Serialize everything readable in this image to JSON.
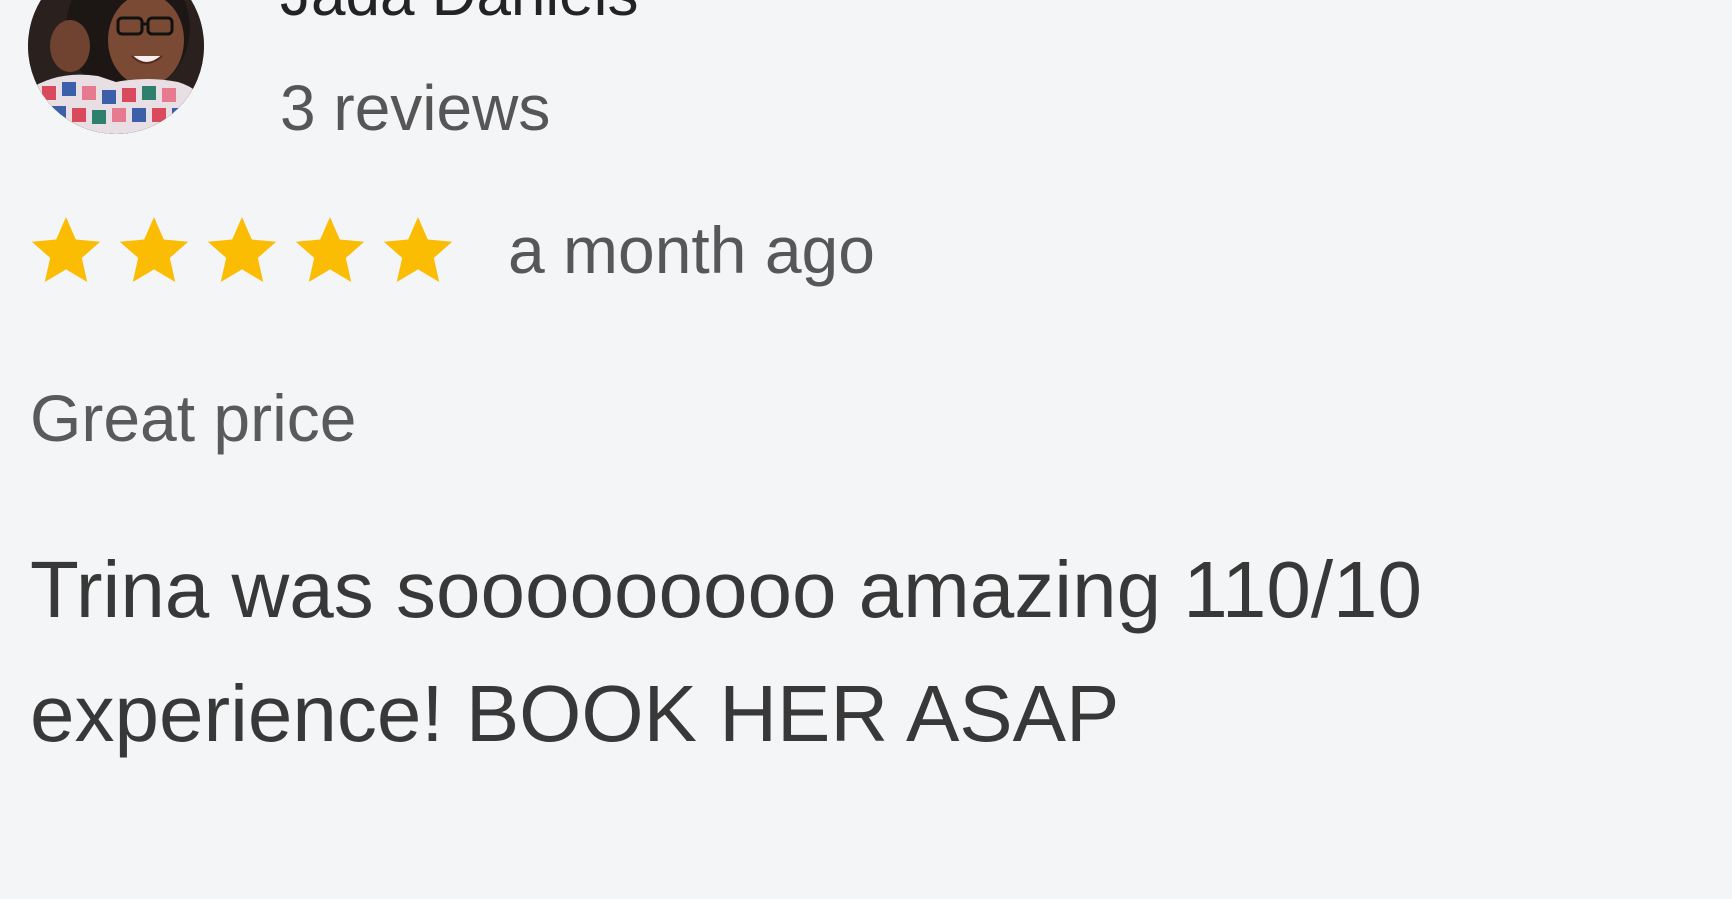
{
  "review": {
    "reviewer_name": "Jada Daniels",
    "review_count": "3 reviews",
    "rating": 5,
    "rating_max": 5,
    "time_ago": "a month ago",
    "tag": "Great price",
    "text": "Trina was sooooooooo amazing 110/10 experience! BOOK HER ASAP"
  },
  "icons": {
    "star": "star-icon",
    "avatar": "profile-photo"
  },
  "colors": {
    "background": "#f4f5f7",
    "star": "#fbbc04",
    "primary_text": "#232323",
    "secondary_text": "#575757"
  }
}
